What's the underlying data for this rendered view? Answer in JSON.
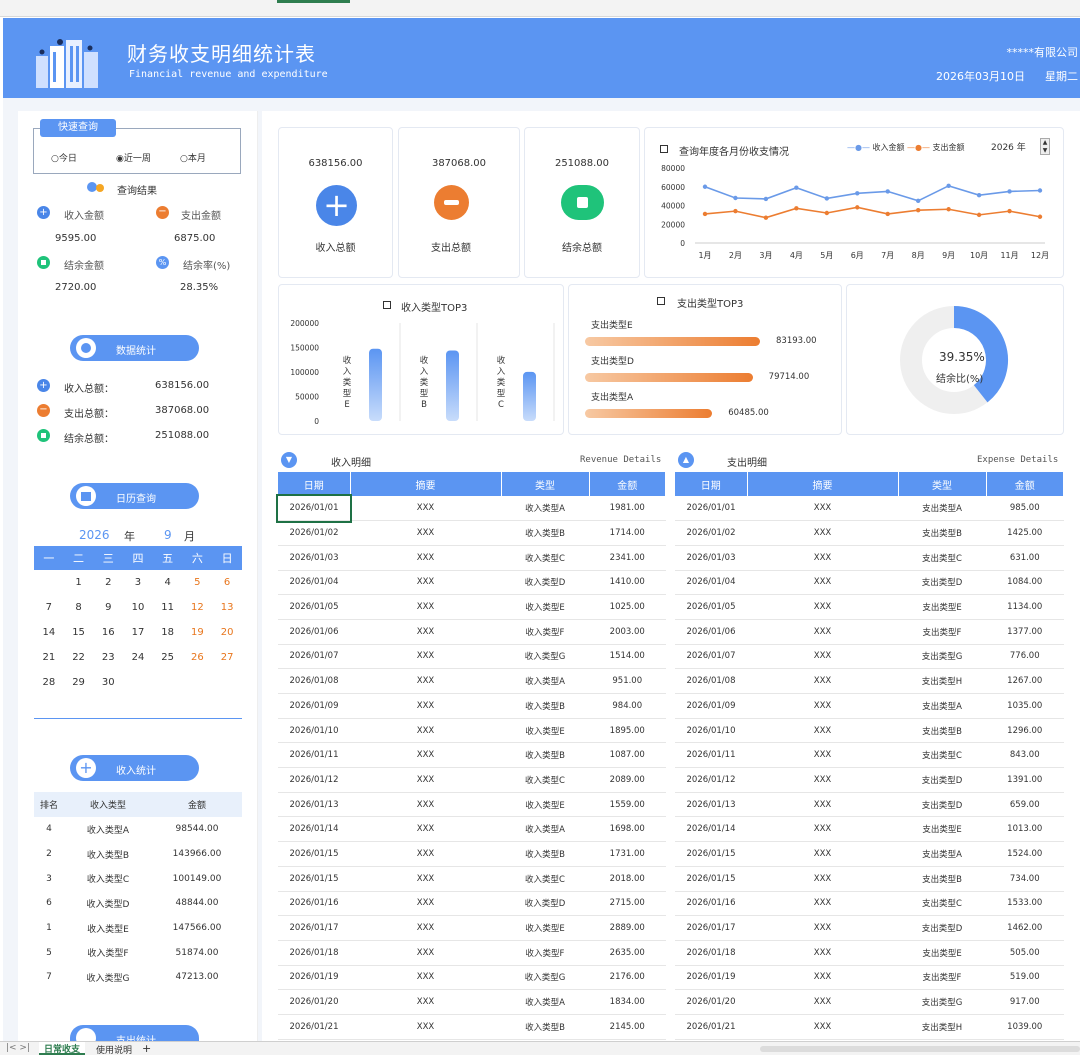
{
  "header": {
    "title": "财务收支明细统计表",
    "subtitle": "Financial revenue and expenditure",
    "company": "*****有限公司",
    "date": "2026年03月10日",
    "weekday": "星期二"
  },
  "quick_query": {
    "title": "快速查询",
    "options": [
      "今日",
      "近一周",
      "本月"
    ],
    "selected": "近一周",
    "result_title": "查询结果",
    "income_label": "收入金额",
    "income_value": "9595.00",
    "expense_label": "支出金额",
    "expense_value": "6875.00",
    "balance_label": "结余金额",
    "balance_value": "2720.00",
    "rate_label": "结余率(%)",
    "rate_value": "28.35%"
  },
  "data_stats": {
    "button": "数据统计",
    "rows": [
      {
        "label": "收入总额：",
        "value": "638156.00"
      },
      {
        "label": "支出总额：",
        "value": "387068.00"
      },
      {
        "label": "结余总额：",
        "value": "251088.00"
      }
    ]
  },
  "calendar": {
    "button": "日历查询",
    "year": "2026",
    "year_unit": "年",
    "month": "9",
    "month_unit": "月",
    "weekdays": [
      "一",
      "二",
      "三",
      "四",
      "五",
      "六",
      "日"
    ],
    "weeks": [
      [
        "",
        "1",
        "2",
        "3",
        "4",
        "5",
        "6"
      ],
      [
        "7",
        "8",
        "9",
        "10",
        "11",
        "12",
        "13"
      ],
      [
        "14",
        "15",
        "16",
        "17",
        "18",
        "19",
        "20"
      ],
      [
        "21",
        "22",
        "23",
        "24",
        "25",
        "26",
        "27"
      ],
      [
        "28",
        "29",
        "30",
        "",
        "",
        "",
        ""
      ]
    ]
  },
  "income_stats": {
    "button": "收入统计",
    "headers": [
      "排名",
      "收入类型",
      "金额"
    ],
    "rows": [
      [
        "4",
        "收入类型A",
        "98544.00"
      ],
      [
        "2",
        "收入类型B",
        "143966.00"
      ],
      [
        "3",
        "收入类型C",
        "100149.00"
      ],
      [
        "6",
        "收入类型D",
        "48844.00"
      ],
      [
        "1",
        "收入类型E",
        "147566.00"
      ],
      [
        "5",
        "收入类型F",
        "51874.00"
      ],
      [
        "7",
        "收入类型G",
        "47213.00"
      ]
    ]
  },
  "expense_stats": {
    "button": "支出统计"
  },
  "kpis": [
    {
      "value": "638156.00",
      "label": "收入总额",
      "color": "#4a86e8",
      "icon": "plus-icon"
    },
    {
      "value": "387068.00",
      "label": "支出总额",
      "color": "#ec7d31",
      "icon": "minus-icon"
    },
    {
      "value": "251088.00",
      "label": "结余总额",
      "color": "#1fc37a",
      "icon": "square-icon"
    }
  ],
  "income_top3": {
    "title": "收入类型TOP3"
  },
  "expense_top3": {
    "title": "支出类型TOP3",
    "rows": [
      {
        "label": "支出类型E",
        "value": "83193.00"
      },
      {
        "label": "支出类型D",
        "value": "79714.00"
      },
      {
        "label": "支出类型A",
        "value": "60485.00"
      }
    ]
  },
  "balance_ratio": {
    "value": "39.35%",
    "label": "结余比(%)"
  },
  "chart_data": [
    {
      "type": "line",
      "title": "查询年度各月份收支情况",
      "year_control": "2026",
      "year_unit": "年",
      "categories": [
        "1月",
        "2月",
        "3月",
        "4月",
        "5月",
        "6月",
        "7月",
        "8月",
        "9月",
        "10月",
        "11月",
        "12月"
      ],
      "ylim": [
        0,
        80000
      ],
      "yticks": [
        "80000",
        "60000",
        "40000",
        "20000",
        "0"
      ],
      "legend": "top-right",
      "series": [
        {
          "name": "收入金额",
          "color": "#6a9ae8",
          "values": [
            60000,
            48000,
            47000,
            59000,
            47500,
            53000,
            55000,
            45000,
            61000,
            51000,
            55000,
            56000
          ]
        },
        {
          "name": "支出金额",
          "color": "#ec7d31",
          "values": [
            31000,
            34000,
            27000,
            37000,
            32000,
            38000,
            31000,
            35000,
            36000,
            30000,
            34000,
            28000
          ]
        }
      ]
    },
    {
      "type": "bar",
      "title": "收入类型TOP3",
      "categories": [
        "收入类型E",
        "收入类型B",
        "收入类型C"
      ],
      "values": [
        147566,
        143966,
        100149
      ],
      "ylim": [
        0,
        200000
      ],
      "yticks": [
        "200000",
        "150000",
        "100000",
        "50000",
        "0"
      ]
    },
    {
      "type": "bar",
      "title": "支出类型TOP3",
      "categories": [
        "支出类型E",
        "支出类型D",
        "支出类型A"
      ],
      "values": [
        83193,
        79714,
        60485
      ]
    },
    {
      "type": "pie",
      "title": "结余比(%)",
      "values": [
        39.35,
        60.65
      ]
    }
  ],
  "income_details": {
    "title": "收入明细",
    "title_en": "Revenue Details",
    "headers": [
      "日期",
      "摘要",
      "类型",
      "金额"
    ],
    "rows": [
      [
        "2026/01/01",
        "XXX",
        "收入类型A",
        "1981.00"
      ],
      [
        "2026/01/02",
        "XXX",
        "收入类型B",
        "1714.00"
      ],
      [
        "2026/01/03",
        "XXX",
        "收入类型C",
        "2341.00"
      ],
      [
        "2026/01/04",
        "XXX",
        "收入类型D",
        "1410.00"
      ],
      [
        "2026/01/05",
        "XXX",
        "收入类型E",
        "1025.00"
      ],
      [
        "2026/01/06",
        "XXX",
        "收入类型F",
        "2003.00"
      ],
      [
        "2026/01/07",
        "XXX",
        "收入类型G",
        "1514.00"
      ],
      [
        "2026/01/08",
        "XXX",
        "收入类型A",
        "951.00"
      ],
      [
        "2026/01/09",
        "XXX",
        "收入类型B",
        "984.00"
      ],
      [
        "2026/01/10",
        "XXX",
        "收入类型E",
        "1895.00"
      ],
      [
        "2026/01/11",
        "XXX",
        "收入类型B",
        "1087.00"
      ],
      [
        "2026/01/12",
        "XXX",
        "收入类型C",
        "2089.00"
      ],
      [
        "2026/01/13",
        "XXX",
        "收入类型E",
        "1559.00"
      ],
      [
        "2026/01/14",
        "XXX",
        "收入类型A",
        "1698.00"
      ],
      [
        "2026/01/15",
        "XXX",
        "收入类型B",
        "1731.00"
      ],
      [
        "2026/01/15",
        "XXX",
        "收入类型C",
        "2018.00"
      ],
      [
        "2026/01/16",
        "XXX",
        "收入类型D",
        "2715.00"
      ],
      [
        "2026/01/17",
        "XXX",
        "收入类型E",
        "2889.00"
      ],
      [
        "2026/01/18",
        "XXX",
        "收入类型F",
        "2635.00"
      ],
      [
        "2026/01/19",
        "XXX",
        "收入类型G",
        "2176.00"
      ],
      [
        "2026/01/20",
        "XXX",
        "收入类型A",
        "1834.00"
      ],
      [
        "2026/01/21",
        "XXX",
        "收入类型B",
        "2145.00"
      ]
    ]
  },
  "expense_details": {
    "title": "支出明细",
    "title_en": "Expense Details",
    "headers": [
      "日期",
      "摘要",
      "类型",
      "金额"
    ],
    "rows": [
      [
        "2026/01/01",
        "XXX",
        "支出类型A",
        "985.00"
      ],
      [
        "2026/01/02",
        "XXX",
        "支出类型B",
        "1425.00"
      ],
      [
        "2026/01/03",
        "XXX",
        "支出类型C",
        "631.00"
      ],
      [
        "2026/01/04",
        "XXX",
        "支出类型D",
        "1084.00"
      ],
      [
        "2026/01/05",
        "XXX",
        "支出类型E",
        "1134.00"
      ],
      [
        "2026/01/06",
        "XXX",
        "支出类型F",
        "1377.00"
      ],
      [
        "2026/01/07",
        "XXX",
        "支出类型G",
        "776.00"
      ],
      [
        "2026/01/08",
        "XXX",
        "支出类型H",
        "1267.00"
      ],
      [
        "2026/01/09",
        "XXX",
        "支出类型A",
        "1035.00"
      ],
      [
        "2026/01/10",
        "XXX",
        "支出类型B",
        "1296.00"
      ],
      [
        "2026/01/11",
        "XXX",
        "支出类型C",
        "843.00"
      ],
      [
        "2026/01/12",
        "XXX",
        "支出类型D",
        "1391.00"
      ],
      [
        "2026/01/13",
        "XXX",
        "支出类型D",
        "659.00"
      ],
      [
        "2026/01/14",
        "XXX",
        "支出类型E",
        "1013.00"
      ],
      [
        "2026/01/15",
        "XXX",
        "支出类型A",
        "1524.00"
      ],
      [
        "2026/01/15",
        "XXX",
        "支出类型B",
        "734.00"
      ],
      [
        "2026/01/16",
        "XXX",
        "支出类型C",
        "1533.00"
      ],
      [
        "2026/01/17",
        "XXX",
        "支出类型D",
        "1462.00"
      ],
      [
        "2026/01/18",
        "XXX",
        "支出类型E",
        "505.00"
      ],
      [
        "2026/01/19",
        "XXX",
        "支出类型F",
        "519.00"
      ],
      [
        "2026/01/20",
        "XXX",
        "支出类型G",
        "917.00"
      ],
      [
        "2026/01/21",
        "XXX",
        "支出类型H",
        "1039.00"
      ]
    ]
  },
  "sheet_tabs": {
    "nav": "|< >|",
    "tabs": [
      "日常收支",
      "使用说明"
    ],
    "add": "+",
    "active": "日常收支"
  }
}
